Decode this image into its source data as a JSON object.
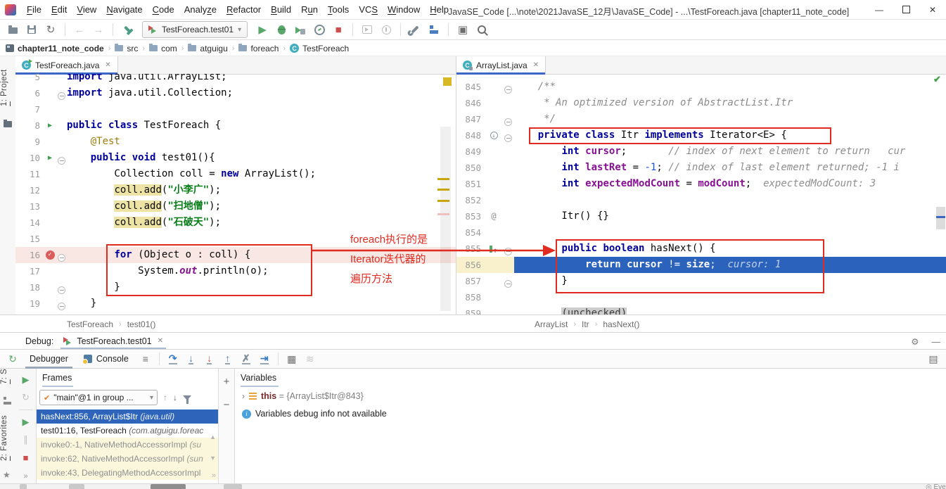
{
  "titlebar": {
    "menus": [
      {
        "pre": "",
        "u": "F",
        "post": "ile"
      },
      {
        "pre": "",
        "u": "E",
        "post": "dit"
      },
      {
        "pre": "",
        "u": "V",
        "post": "iew"
      },
      {
        "pre": "",
        "u": "N",
        "post": "avigate"
      },
      {
        "pre": "",
        "u": "C",
        "post": "ode"
      },
      {
        "pre": "Analy",
        "u": "z",
        "post": "e"
      },
      {
        "pre": "",
        "u": "R",
        "post": "efactor"
      },
      {
        "pre": "",
        "u": "B",
        "post": "uild"
      },
      {
        "pre": "R",
        "u": "u",
        "post": "n"
      },
      {
        "pre": "",
        "u": "T",
        "post": "ools"
      },
      {
        "pre": "VC",
        "u": "S",
        "post": ""
      },
      {
        "pre": "",
        "u": "W",
        "post": "indow"
      },
      {
        "pre": "",
        "u": "H",
        "post": "elp"
      }
    ],
    "title": "JavaSE_Code [...\\note\\2021JavaSE_12月\\JavaSE_Code] - ...\\TestForeach.java [chapter11_note_code]"
  },
  "toolbar": {
    "run_config": "TestForeach.test01"
  },
  "navbar": {
    "items": [
      {
        "label": "chapter11_note_code",
        "icon": "module",
        "bold": true
      },
      {
        "label": "src",
        "icon": "folder"
      },
      {
        "label": "com",
        "icon": "folder"
      },
      {
        "label": "atguigu",
        "icon": "folder"
      },
      {
        "label": "foreach",
        "icon": "folder"
      },
      {
        "label": "TestForeach",
        "icon": "class"
      }
    ]
  },
  "tool_strips": {
    "project": {
      "u": "1",
      "rest": ": Project"
    },
    "structure": {
      "u": "7",
      "rest": ": Structure"
    },
    "favorites": {
      "u": "2",
      "rest": ": Favorites"
    }
  },
  "left_editor": {
    "tab": "TestForeach.java",
    "breadcrumb": [
      "TestForeach",
      "test01()"
    ],
    "lines": [
      {
        "n": "5",
        "s": [
          [
            "import",
            "kw"
          ],
          [
            " java.util.ArrayList;"
          ]
        ]
      },
      {
        "n": "6",
        "fold": true,
        "s": [
          [
            "import",
            "kw"
          ],
          [
            " java.util.Collection;"
          ]
        ]
      },
      {
        "n": "7",
        "s": []
      },
      {
        "n": "8",
        "ic": "run",
        "s": [
          [
            "public class",
            "kw"
          ],
          [
            " TestForeach {"
          ]
        ]
      },
      {
        "n": "9",
        "s": [
          [
            "    "
          ],
          [
            "@Test",
            "ann"
          ]
        ]
      },
      {
        "n": "10",
        "ic": "run",
        "fold": true,
        "s": [
          [
            "    "
          ],
          [
            "public void",
            "kw"
          ],
          [
            " test01(){"
          ]
        ]
      },
      {
        "n": "11",
        "s": [
          [
            "        Collection coll = "
          ],
          [
            "new",
            "kw"
          ],
          [
            " ArrayList();"
          ]
        ]
      },
      {
        "n": "12",
        "s": [
          [
            "        "
          ],
          [
            "coll.add",
            "hl"
          ],
          [
            "("
          ],
          [
            "\"小李广\"",
            "str"
          ],
          [
            ");"
          ]
        ]
      },
      {
        "n": "13",
        "s": [
          [
            "        "
          ],
          [
            "coll.add",
            "hl"
          ],
          [
            "("
          ],
          [
            "\"扫地僧\"",
            "str"
          ],
          [
            ");"
          ]
        ]
      },
      {
        "n": "14",
        "s": [
          [
            "        "
          ],
          [
            "coll.add",
            "hl"
          ],
          [
            "("
          ],
          [
            "\"石破天\"",
            "str"
          ],
          [
            ");"
          ]
        ]
      },
      {
        "n": "15",
        "s": []
      },
      {
        "n": "16",
        "ic": "bp",
        "fold": true,
        "cls": "bp",
        "s": [
          [
            "        "
          ],
          [
            "for",
            "kw"
          ],
          [
            " (Object o : coll) {"
          ]
        ]
      },
      {
        "n": "17",
        "s": [
          [
            "            System."
          ],
          [
            "out",
            "out"
          ],
          [
            ".println(o);"
          ]
        ]
      },
      {
        "n": "18",
        "fold": true,
        "s": [
          [
            "        }"
          ]
        ]
      },
      {
        "n": "19",
        "fold": true,
        "s": [
          [
            "    }"
          ]
        ]
      }
    ]
  },
  "right_editor": {
    "tab": "ArrayList.java",
    "breadcrumb": [
      "ArrayList",
      "Itr",
      "hasNext()"
    ],
    "lines": [
      {
        "n": "845",
        "fold": true,
        "s": [
          [
            "    /**",
            "cmt"
          ]
        ]
      },
      {
        "n": "846",
        "s": [
          [
            "     * An optimized version of AbstractList.Itr",
            "cmt"
          ]
        ]
      },
      {
        "n": "847",
        "fold": true,
        "s": [
          [
            "     */",
            "cmt"
          ]
        ]
      },
      {
        "n": "848",
        "ic": "ovr",
        "fold": true,
        "s": [
          [
            "    "
          ],
          [
            "private class",
            "kw"
          ],
          [
            " Itr "
          ],
          [
            "implements",
            "kw"
          ],
          [
            " Iterator<E> {"
          ]
        ]
      },
      {
        "n": "849",
        "s": [
          [
            "        "
          ],
          [
            "int",
            "kw"
          ],
          [
            " "
          ],
          [
            "cursor",
            "fld"
          ],
          [
            ";       "
          ],
          [
            "// index of next element to return   ",
            "cmt"
          ],
          [
            "cur",
            "hint"
          ]
        ]
      },
      {
        "n": "850",
        "s": [
          [
            "        "
          ],
          [
            "int",
            "kw"
          ],
          [
            " "
          ],
          [
            "lastRet",
            "fld"
          ],
          [
            " = "
          ],
          [
            "-1",
            "num"
          ],
          [
            "; "
          ],
          [
            "// index of last element returned; -1 i",
            "cmt"
          ]
        ]
      },
      {
        "n": "851",
        "s": [
          [
            "        "
          ],
          [
            "int",
            "kw"
          ],
          [
            " "
          ],
          [
            "expectedModCount",
            "fld"
          ],
          [
            " = "
          ],
          [
            "modCount",
            "fld"
          ],
          [
            ";  "
          ],
          [
            "expectedModCount: 3",
            "hint"
          ]
        ]
      },
      {
        "n": "852",
        "s": []
      },
      {
        "n": "853",
        "ic": "at",
        "s": [
          [
            "        Itr() {}"
          ]
        ]
      },
      {
        "n": "854",
        "s": []
      },
      {
        "n": "855",
        "ic": "frame",
        "fold": true,
        "s": [
          [
            "        "
          ],
          [
            "public boolean",
            "kw"
          ],
          [
            " hasNext() {"
          ]
        ]
      },
      {
        "n": "856",
        "cls": "exec",
        "s": [
          [
            "            "
          ],
          [
            "return",
            "kw"
          ],
          [
            " "
          ],
          [
            "cursor",
            "b"
          ],
          [
            " != "
          ],
          [
            "size",
            "b"
          ],
          [
            ";  "
          ],
          [
            "cursor: 1",
            "hint"
          ]
        ]
      },
      {
        "n": "857",
        "fold": true,
        "s": [
          [
            "        }"
          ]
        ]
      },
      {
        "n": "858",
        "s": []
      },
      {
        "n": "859",
        "s": [
          [
            "        "
          ],
          [
            "(unchecked)",
            "unch"
          ]
        ]
      }
    ]
  },
  "annotations": {
    "text_lines": [
      "foreach执行的是",
      "Iterator迭代器的",
      "遍历方法"
    ],
    "color": "#E02B20"
  },
  "debug": {
    "label": "Debug:",
    "session_tab": "TestForeach.test01",
    "tabs": {
      "debugger": "Debugger",
      "console": "Console"
    },
    "frames": {
      "header": "Frames",
      "thread": "\"main\"@1 in group ...",
      "rows": [
        {
          "cls": "sel",
          "main": "hasNext:856, ArrayList$Itr ",
          "pkg": "(java.util)"
        },
        {
          "cls": "usr",
          "main": "test01:16, TestForeach ",
          "pkg": "(com.atguigu.foreac"
        },
        {
          "cls": "lib",
          "main": "invoke0:-1, NativeMethodAccessorImpl ",
          "pkg": "(su"
        },
        {
          "cls": "lib",
          "main": "invoke:62, NativeMethodAccessorImpl ",
          "pkg": "(sun"
        },
        {
          "cls": "lib",
          "main": "invoke:43, DelegatingMethodAccessorImpl",
          "pkg": ""
        }
      ]
    },
    "variables": {
      "header": "Variables",
      "this_name": "this",
      "this_eq": " = ",
      "this_value": "{ArrayList$Itr@843}",
      "info": "Variables debug info not available"
    }
  },
  "status": {
    "event_log": "Event Lo"
  },
  "icons": {
    "sync": "↻",
    "back": "←",
    "forward": "→",
    "run": "▶",
    "stop": "■",
    "toolwindow": "▣",
    "gear": "⚙",
    "min": "—",
    "close": "✕",
    "tab_close": "✕",
    "chev": "›",
    "combo_arrow": "▾",
    "rerun": "↻",
    "refresh": "↻",
    "pause": "∥",
    "more": "»",
    "menu": "≡",
    "step_over": "↷",
    "step_into": "↓",
    "force_step_into": "↓",
    "step_out": "↑",
    "drop_frame": "✗",
    "run_to_cursor": "⇥",
    "evaluate": "▦",
    "trace": "≋",
    "layout": "▤",
    "up": "↑",
    "down": "↓",
    "plus": "+",
    "minus": "−",
    "check": "✔",
    "scroll_up": "▲",
    "scroll_down": "▼",
    "bp_check": "✓",
    "override": "↓",
    "at": "@",
    "frame_arrow": "↑",
    "class_c": "C",
    "expander": "›",
    "info": "i",
    "green_check": "✔",
    "event": "◎"
  }
}
